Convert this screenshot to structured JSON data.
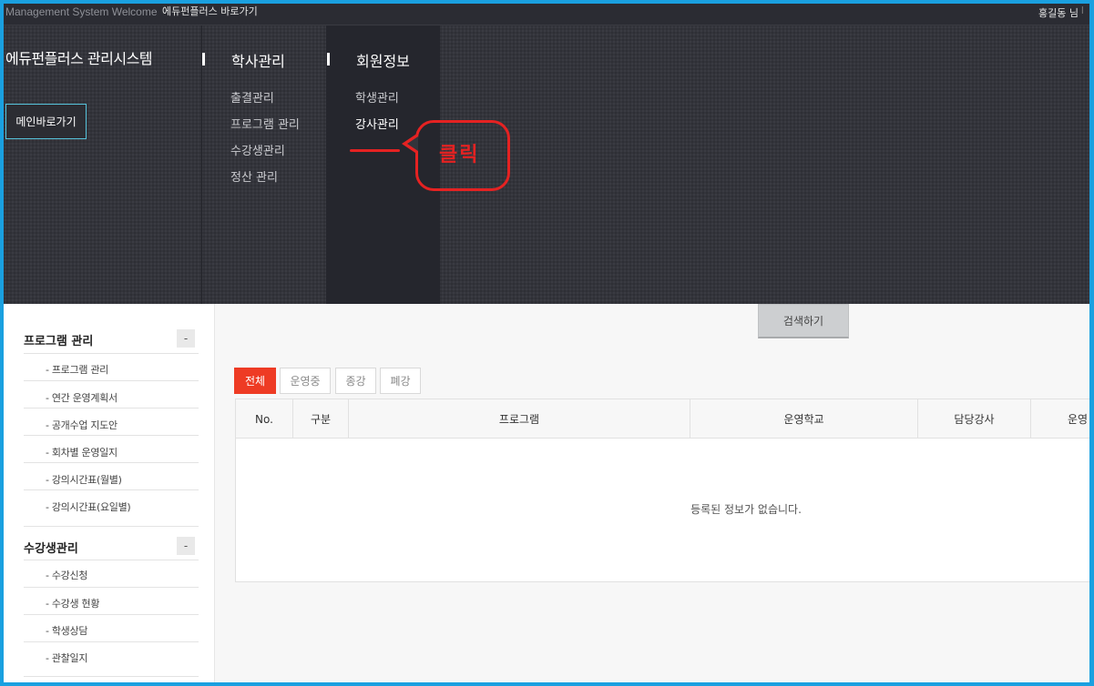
{
  "topbar": {
    "welcome": "Management System Welcome",
    "shortcut": "에듀펀플러스 바로가기",
    "user": "홍길동 님",
    "separator": "I"
  },
  "header": {
    "brand": "에듀펀플러스 관리시스템",
    "home_button": "메인바로가기"
  },
  "menus": [
    {
      "title": "학사관리",
      "items": [
        "출결관리",
        "프로그램 관리",
        "수강생관리",
        "정산 관리"
      ]
    },
    {
      "title": "회원정보",
      "items": [
        "학생관리",
        "강사관리"
      ]
    }
  ],
  "annotation": {
    "text": "클릭",
    "color": "#e52222"
  },
  "sidebar": {
    "groups": [
      {
        "title": "프로그램 관리",
        "toggle": "-",
        "items": [
          "- 프로그램 관리",
          "- 연간 운영계획서",
          "- 공개수업 지도안",
          "- 회차별 운영일지",
          "- 강의시간표(월별)",
          "- 강의시간표(요일별)"
        ]
      },
      {
        "title": "수강생관리",
        "toggle": "-",
        "items": [
          "- 수강신청",
          "- 수강생 현황",
          "- 학생상담",
          "- 관찰일지"
        ]
      }
    ]
  },
  "main": {
    "search_button": "검색하기",
    "filters": [
      "전체",
      "운영중",
      "종강",
      "폐강"
    ],
    "table": {
      "columns": [
        "No.",
        "구분",
        "프로그램",
        "운영학교",
        "담당강사",
        "운영"
      ],
      "empty_message": "등록된 정보가 없습니다."
    }
  },
  "colors": {
    "accent": "#ee3b24",
    "frame": "#1aa0e0",
    "header_bg": "#33343b"
  }
}
